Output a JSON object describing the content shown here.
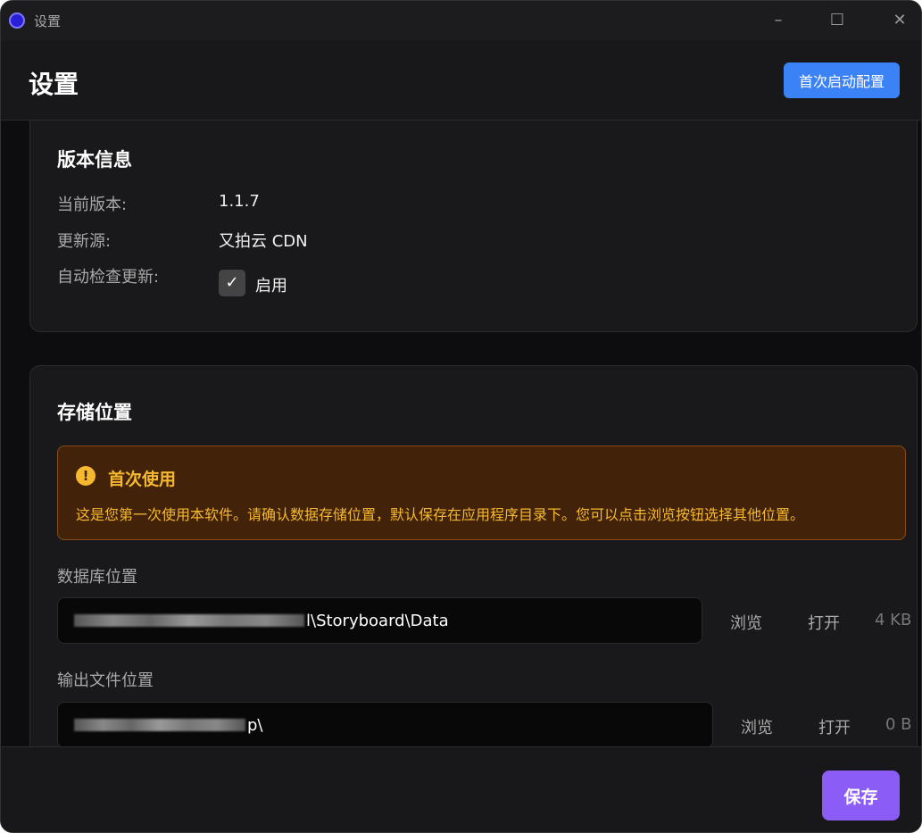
{
  "window": {
    "title": "设置",
    "minimize": "–",
    "maximize": "☐",
    "close": "✕"
  },
  "header": {
    "title": "设置",
    "first_launch_button": "首次启动配置"
  },
  "version": {
    "title": "版本信息",
    "current_label": "当前版本:",
    "current_value": "1.1.7",
    "source_label": "更新源:",
    "source_value": "又拍云 CDN",
    "auto_check_label": "自动检查更新:",
    "auto_check_checked": true,
    "auto_check_option": "启用"
  },
  "storage": {
    "title": "存储位置",
    "alert": {
      "title": "首次使用",
      "text": "这是您第一次使用本软件。请确认数据存储位置，默认保存在应用程序目录下。您可以点击浏览按钮选择其他位置。"
    },
    "database": {
      "label": "数据库位置",
      "path_visible": "l\\Storyboard\\Data",
      "browse": "浏览",
      "open": "打开",
      "size": "4 KB"
    },
    "output": {
      "label": "输出文件位置",
      "path_visible": "p\\",
      "browse": "浏览",
      "open": "打开",
      "size": "0 B"
    }
  },
  "footer": {
    "save": "保存"
  }
}
